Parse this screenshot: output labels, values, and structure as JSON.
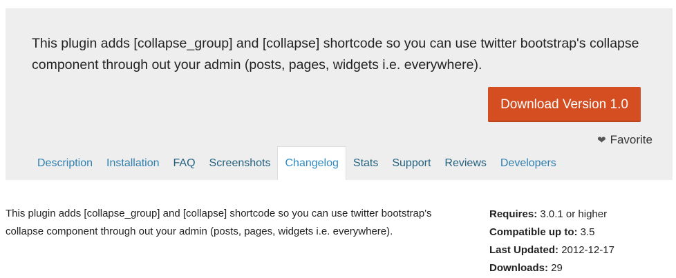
{
  "header": {
    "description": "This plugin adds [collapse_group] and [collapse] shortcode so you can use twitter bootstrap's collapse component through out your admin (posts, pages, widgets i.e. everywhere).",
    "download_label": "Download Version 1.0",
    "favorite_label": "Favorite",
    "favorite_icon": "heart-icon"
  },
  "tabs": [
    {
      "label": "Description"
    },
    {
      "label": "Installation"
    },
    {
      "label": "FAQ"
    },
    {
      "label": "Screenshots"
    },
    {
      "label": "Changelog",
      "active": true
    },
    {
      "label": "Stats"
    },
    {
      "label": "Support"
    },
    {
      "label": "Reviews"
    },
    {
      "label": "Developers"
    }
  ],
  "content": {
    "description": "This plugin adds [collapse_group] and [collapse] shortcode so you can use twitter bootstrap's collapse component through out your admin (posts, pages, widgets i.e. everywhere)."
  },
  "meta": {
    "requires_label": "Requires:",
    "requires_value": "3.0.1 or higher",
    "compatible_label": "Compatible up to:",
    "compatible_value": "3.5",
    "updated_label": "Last Updated:",
    "updated_value": "2012-12-17",
    "downloads_label": "Downloads:",
    "downloads_value": "29"
  },
  "colors": {
    "accent": "#d54e21",
    "link": "#2e7fb0",
    "panel": "#eeeeee"
  }
}
